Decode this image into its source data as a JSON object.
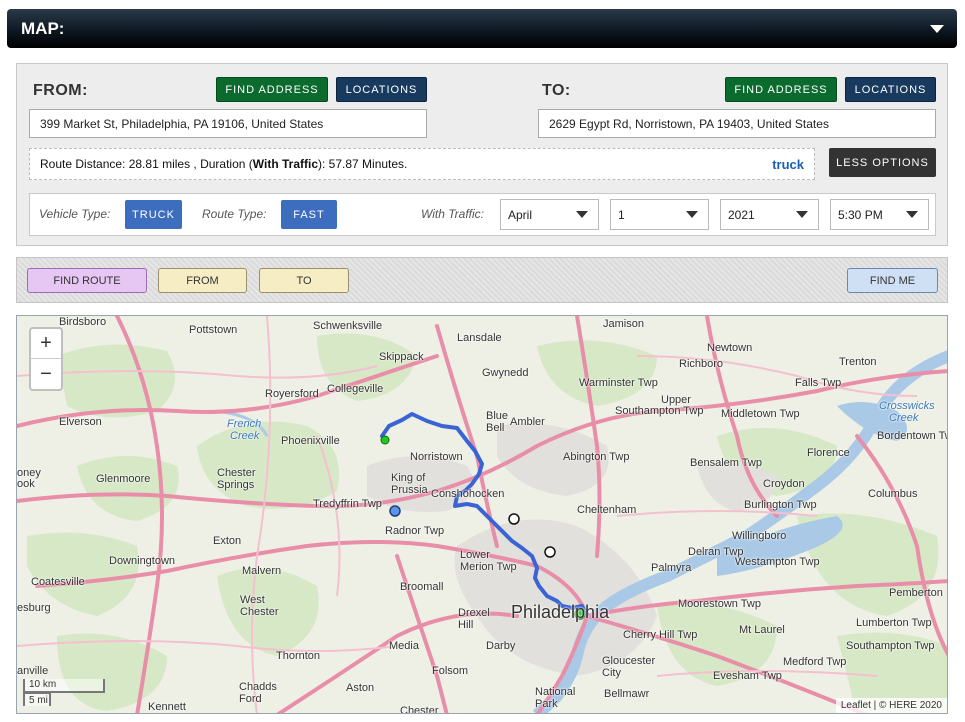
{
  "header": {
    "title": "MAP:"
  },
  "route": {
    "from_label": "FROM:",
    "to_label": "TO:",
    "find_address_label": "FIND ADDRESS",
    "locations_label": "LOCATIONS",
    "from_address": "399 Market St, Philadelphia, PA 19106, United States",
    "to_address": "2629 Egypt Rd, Norristown, PA 19403, United States",
    "summary_prefix": "Route Distance: 28.81 miles , Duration (",
    "summary_bold": "With Traffic",
    "summary_suffix": "): 57.87 Minutes.",
    "mode_label": "truck",
    "less_options_label": "LESS OPTIONS"
  },
  "options": {
    "vehicle_type_label": "Vehicle Type:",
    "vehicle_type_value": "TRUCK",
    "route_type_label": "Route Type:",
    "route_type_value": "FAST",
    "with_traffic_label": "With Traffic:",
    "month": "April",
    "day": "1",
    "year": "2021",
    "time": "5:30 PM"
  },
  "actions": {
    "find_route": "FIND ROUTE",
    "from": "FROM",
    "to": "TO",
    "find_me": "FIND ME"
  },
  "map": {
    "zoom_in": "+",
    "zoom_out": "−",
    "scale_km": "10 km",
    "scale_mi": "5 mi",
    "attribution": "Leaflet | © HERE 2020",
    "route_color": "#3a63d4",
    "labels": [
      {
        "text": "Birdsboro"
      },
      {
        "text": "Pottstown"
      },
      {
        "text": "Schwenksville"
      },
      {
        "text": "Lansdale"
      },
      {
        "text": "Jamison"
      },
      {
        "text": "Newtown"
      },
      {
        "text": "Richboro"
      },
      {
        "text": "Trenton"
      },
      {
        "text": "Skippack"
      },
      {
        "text": "Gwynedd"
      },
      {
        "text": "Warminster Twp"
      },
      {
        "text": "Falls Twp"
      },
      {
        "text": "Collegeville"
      },
      {
        "text": "Royersford"
      },
      {
        "text": "Upper"
      },
      {
        "text": "Southampton Twp"
      },
      {
        "text": "Middletown Twp"
      },
      {
        "text": "Crosswicks"
      },
      {
        "text": "Creek"
      },
      {
        "text": "Elverson"
      },
      {
        "text": "French"
      },
      {
        "text": "Creek"
      },
      {
        "text": "Blue"
      },
      {
        "text": "Bell"
      },
      {
        "text": "Ambler"
      },
      {
        "text": "Bordentown Twp"
      },
      {
        "text": "Phoenixville"
      },
      {
        "text": "Norristown"
      },
      {
        "text": "Abington Twp"
      },
      {
        "text": "Bensalem Twp"
      },
      {
        "text": "Florence"
      },
      {
        "text": "oney"
      },
      {
        "text": "ook"
      },
      {
        "text": "Glenmoore"
      },
      {
        "text": "Chester"
      },
      {
        "text": "Springs"
      },
      {
        "text": "King of"
      },
      {
        "text": "Prussia"
      },
      {
        "text": "Croydon"
      },
      {
        "text": "Columbus"
      },
      {
        "text": "Conshohocken"
      },
      {
        "text": "Tredyffrin Twp"
      },
      {
        "text": "Cheltenham"
      },
      {
        "text": "Burlington Twp"
      },
      {
        "text": "Radnor Twp"
      },
      {
        "text": "Exton"
      },
      {
        "text": "Willingboro"
      },
      {
        "text": "Lower"
      },
      {
        "text": "Merion Twp"
      },
      {
        "text": "Delran Twp"
      },
      {
        "text": "Downingtown"
      },
      {
        "text": "Malvern"
      },
      {
        "text": "Westampton Twp"
      },
      {
        "text": "Coatesville"
      },
      {
        "text": "Broomall"
      },
      {
        "text": "Palmyra"
      },
      {
        "text": "Pemberton"
      },
      {
        "text": "West"
      },
      {
        "text": "Chester"
      },
      {
        "text": "Drexel"
      },
      {
        "text": "Hill"
      },
      {
        "text": "Philadelphia"
      },
      {
        "text": "Moorestown Twp"
      },
      {
        "text": "Lumberton Twp"
      },
      {
        "text": "esburg"
      },
      {
        "text": "Cherry Hill Twp"
      },
      {
        "text": "Mt Laurel"
      },
      {
        "text": "Media"
      },
      {
        "text": "Darby"
      },
      {
        "text": "Southampton Twp"
      },
      {
        "text": "Thornton"
      },
      {
        "text": "Gloucester"
      },
      {
        "text": "City"
      },
      {
        "text": "Medford Twp"
      },
      {
        "text": "anville"
      },
      {
        "text": "Chadds"
      },
      {
        "text": "Ford"
      },
      {
        "text": "Aston"
      },
      {
        "text": "Folsom"
      },
      {
        "text": "National"
      },
      {
        "text": "Park"
      },
      {
        "text": "Evesham Twp"
      },
      {
        "text": "Bellmawr"
      },
      {
        "text": "Kennett"
      },
      {
        "text": "Chester"
      }
    ]
  }
}
